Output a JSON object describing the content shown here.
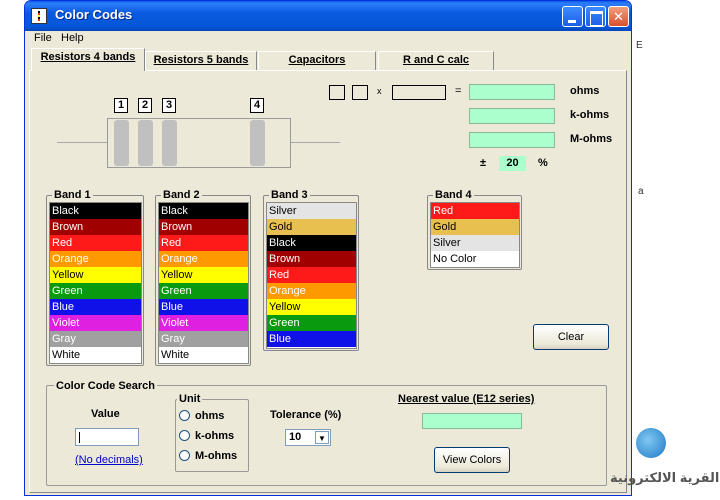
{
  "window": {
    "title": "Color Codes"
  },
  "menu": {
    "file": "File",
    "help": "Help"
  },
  "tabs": [
    {
      "label": "Resistors 4 bands",
      "active": true
    },
    {
      "label": "Resistors 5 bands",
      "active": false
    },
    {
      "label": "Capacitors",
      "active": false
    },
    {
      "label": "R and C calc",
      "active": false
    }
  ],
  "resistor": {
    "band_numbers": [
      "1",
      "2",
      "3",
      "4"
    ]
  },
  "calc": {
    "times": "x",
    "equals": "=",
    "units": [
      "ohms",
      "k-ohms",
      "M-ohms"
    ],
    "tolerance_sign": "±",
    "tolerance_value": "20",
    "percent": "%"
  },
  "bands": {
    "band1": {
      "title": "Band 1",
      "items": [
        {
          "label": "Black",
          "color": "#000000",
          "text": "#ffffff"
        },
        {
          "label": "Brown",
          "color": "#a00000",
          "text": "#ffffff"
        },
        {
          "label": "Red",
          "color": "#ff1a1a",
          "text": "#ffffff"
        },
        {
          "label": "Orange",
          "color": "#ff9900",
          "text": "#ffffff"
        },
        {
          "label": "Yellow",
          "color": "#ffff00",
          "text": "#000000"
        },
        {
          "label": "Green",
          "color": "#0a9a10",
          "text": "#ffffff"
        },
        {
          "label": "Blue",
          "color": "#1010e8",
          "text": "#ffffff"
        },
        {
          "label": "Violet",
          "color": "#e020e0",
          "text": "#ffffff"
        },
        {
          "label": "Gray",
          "color": "#a0a0a0",
          "text": "#ffffff"
        },
        {
          "label": "White",
          "color": "#ffffff",
          "text": "#000000"
        }
      ]
    },
    "band2": {
      "title": "Band 2",
      "items": [
        {
          "label": "Black",
          "color": "#000000",
          "text": "#ffffff"
        },
        {
          "label": "Brown",
          "color": "#a00000",
          "text": "#ffffff"
        },
        {
          "label": "Red",
          "color": "#ff1a1a",
          "text": "#ffffff"
        },
        {
          "label": "Orange",
          "color": "#ff9900",
          "text": "#ffffff"
        },
        {
          "label": "Yellow",
          "color": "#ffff00",
          "text": "#000000"
        },
        {
          "label": "Green",
          "color": "#0a9a10",
          "text": "#ffffff"
        },
        {
          "label": "Blue",
          "color": "#1010e8",
          "text": "#ffffff"
        },
        {
          "label": "Violet",
          "color": "#e020e0",
          "text": "#ffffff"
        },
        {
          "label": "Gray",
          "color": "#a0a0a0",
          "text": "#ffffff"
        },
        {
          "label": "White",
          "color": "#ffffff",
          "text": "#000000"
        }
      ]
    },
    "band3": {
      "title": "Band 3",
      "items": [
        {
          "label": "Silver",
          "color": "#e4e4e4",
          "text": "#000000"
        },
        {
          "label": "Gold",
          "color": "#e8c050",
          "text": "#000000"
        },
        {
          "label": "Black",
          "color": "#000000",
          "text": "#ffffff"
        },
        {
          "label": "Brown",
          "color": "#a00000",
          "text": "#ffffff"
        },
        {
          "label": "Red",
          "color": "#ff1a1a",
          "text": "#ffffff"
        },
        {
          "label": "Orange",
          "color": "#ff9900",
          "text": "#ffffff"
        },
        {
          "label": "Yellow",
          "color": "#ffff00",
          "text": "#000000"
        },
        {
          "label": "Green",
          "color": "#0a9a10",
          "text": "#ffffff"
        },
        {
          "label": "Blue",
          "color": "#1010e8",
          "text": "#ffffff"
        }
      ]
    },
    "band4": {
      "title": "Band 4",
      "items": [
        {
          "label": "Red",
          "color": "#ff1a1a",
          "text": "#ffffff"
        },
        {
          "label": "Gold",
          "color": "#e8c050",
          "text": "#000000"
        },
        {
          "label": "Silver",
          "color": "#e4e4e4",
          "text": "#000000"
        },
        {
          "label": "No Color",
          "color": "#ffffff",
          "text": "#000000"
        }
      ]
    }
  },
  "buttons": {
    "clear": "Clear",
    "view_colors": "View Colors"
  },
  "search": {
    "group_title": "Color Code Search",
    "value_label": "Value",
    "value_input": "",
    "no_decimals": "(No decimals)",
    "unit_title": "Unit",
    "unit_options": [
      "ohms",
      "k-ohms",
      "M-ohms"
    ],
    "tolerance_label": "Tolerance (%)",
    "tolerance_selected": "10",
    "nearest_label": "Nearest value (E12 series)"
  },
  "desktop": {
    "watermark_text": "القرية الالكترونية",
    "edge_char_1": "E",
    "edge_char_2": "a"
  },
  "colors": {
    "title_bar": "#0a5ae0",
    "window_bg": "#ece9d8",
    "result_field": "#aaffcc"
  }
}
